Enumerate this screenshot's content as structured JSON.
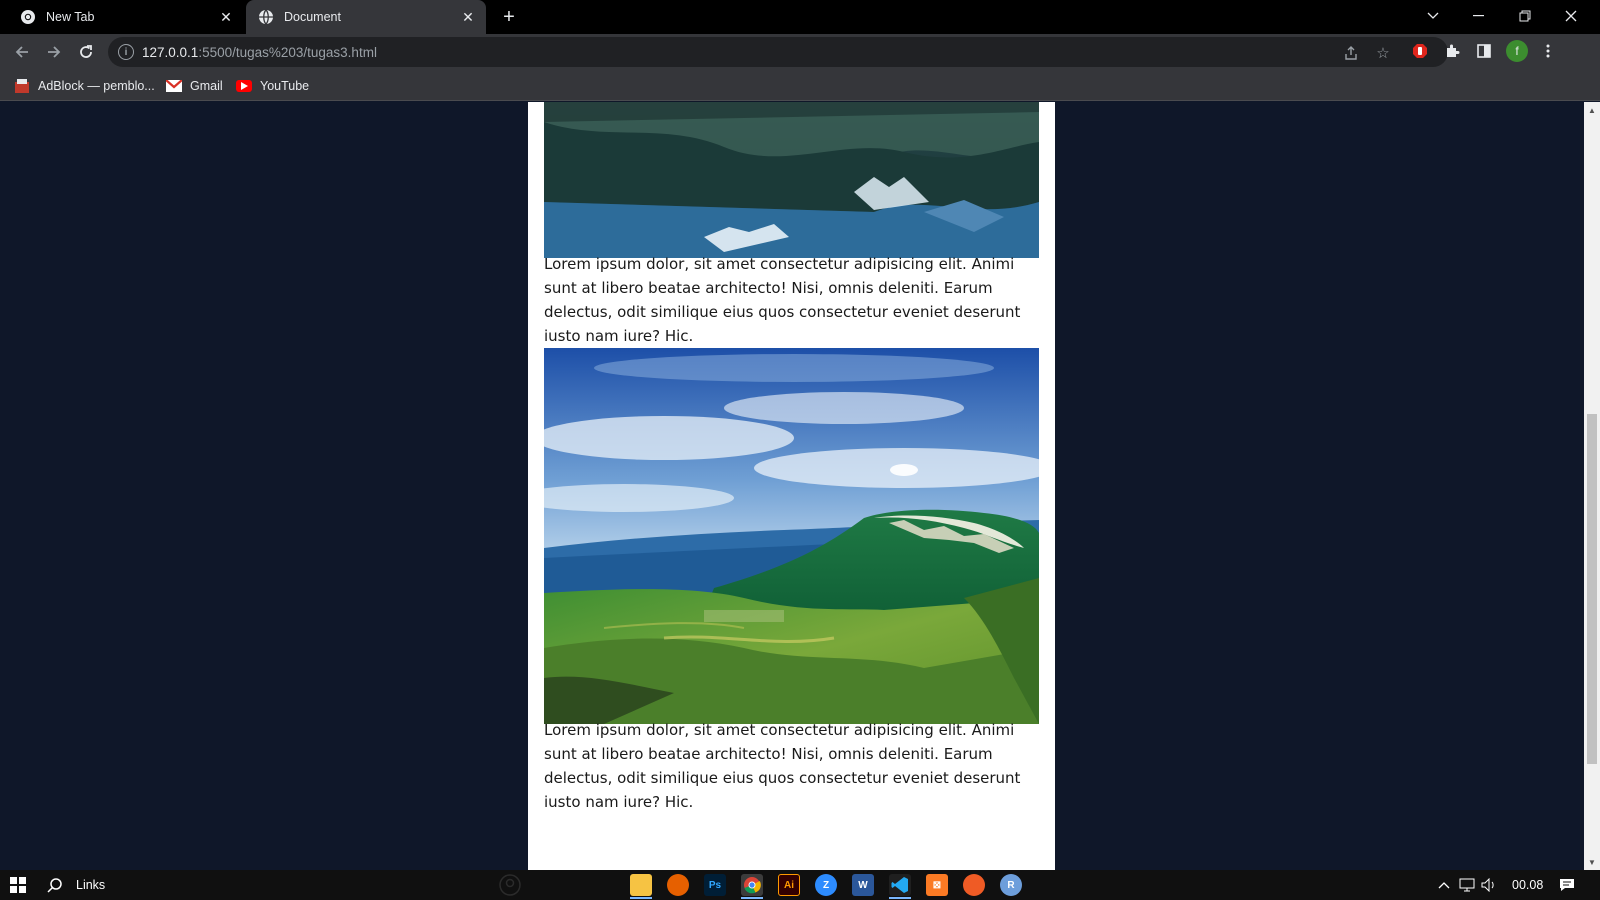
{
  "browser": {
    "tabs": [
      {
        "title": "New Tab",
        "favicon": "chrome-icon",
        "active": false
      },
      {
        "title": "Document",
        "favicon": "globe-icon",
        "active": true
      }
    ],
    "new_tab_icon": "plus-icon",
    "window_controls": [
      "chevron-down-icon",
      "minimize-icon",
      "restore-icon",
      "close-icon"
    ],
    "address_host": "127.0.0.1",
    "address_path": ":5500/tugas%203/tugas3.html",
    "profile_initial": "f",
    "bookmarks": [
      {
        "label": "AdBlock — pemblo...",
        "icon": "adblock-icon"
      },
      {
        "label": "Gmail",
        "icon": "gmail-icon"
      },
      {
        "label": "YouTube",
        "icon": "youtube-icon"
      }
    ]
  },
  "page": {
    "paragraphs": [
      "Lorem ipsum dolor, sit amet consectetur adipisicing elit. Animi sunt at libero beatae architecto! Nisi, omnis deleniti. Earum delectus, odit similique eius quos consectetur eveniet deserunt iusto nam iure? Hic.",
      "Lorem ipsum dolor, sit amet consectetur adipisicing elit. Animi sunt at libero beatae architecto! Nisi, omnis deleniti. Earum delectus, odit similique eius quos consectetur eveniet deserunt iusto nam iure? Hic."
    ],
    "images": [
      "mountain-lake-image",
      "green-valley-image"
    ]
  },
  "taskbar": {
    "search_label": "Links",
    "clock": "00.08",
    "apps": [
      "file-explorer-icon",
      "firefox-icon",
      "photoshop-icon",
      "chrome-icon",
      "illustrator-icon",
      "zoom-icon",
      "word-icon",
      "vscode-icon",
      "xampp-icon",
      "postman-icon",
      "app-r-icon"
    ]
  },
  "colors": {
    "page_background": "#0f1729",
    "container_background": "#ffffff",
    "browser_chrome": "#35363a",
    "tab_strip": "#000000"
  }
}
